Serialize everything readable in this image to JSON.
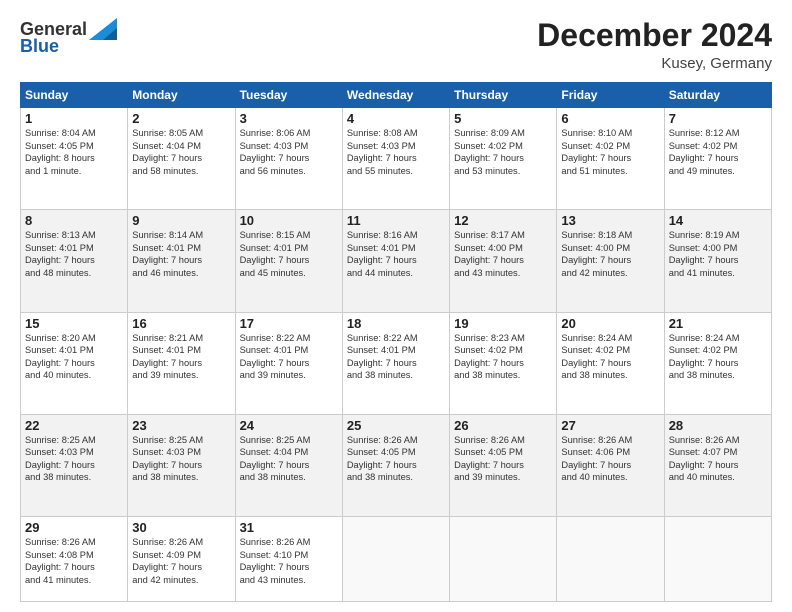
{
  "logo": {
    "general": "General",
    "blue": "Blue"
  },
  "header": {
    "month": "December 2024",
    "location": "Kusey, Germany"
  },
  "weekdays": [
    "Sunday",
    "Monday",
    "Tuesday",
    "Wednesday",
    "Thursday",
    "Friday",
    "Saturday"
  ],
  "weeks": [
    [
      {
        "day": "1",
        "info": "Sunrise: 8:04 AM\nSunset: 4:05 PM\nDaylight: 8 hours\nand 1 minute."
      },
      {
        "day": "2",
        "info": "Sunrise: 8:05 AM\nSunset: 4:04 PM\nDaylight: 7 hours\nand 58 minutes."
      },
      {
        "day": "3",
        "info": "Sunrise: 8:06 AM\nSunset: 4:03 PM\nDaylight: 7 hours\nand 56 minutes."
      },
      {
        "day": "4",
        "info": "Sunrise: 8:08 AM\nSunset: 4:03 PM\nDaylight: 7 hours\nand 55 minutes."
      },
      {
        "day": "5",
        "info": "Sunrise: 8:09 AM\nSunset: 4:02 PM\nDaylight: 7 hours\nand 53 minutes."
      },
      {
        "day": "6",
        "info": "Sunrise: 8:10 AM\nSunset: 4:02 PM\nDaylight: 7 hours\nand 51 minutes."
      },
      {
        "day": "7",
        "info": "Sunrise: 8:12 AM\nSunset: 4:02 PM\nDaylight: 7 hours\nand 49 minutes."
      }
    ],
    [
      {
        "day": "8",
        "info": "Sunrise: 8:13 AM\nSunset: 4:01 PM\nDaylight: 7 hours\nand 48 minutes."
      },
      {
        "day": "9",
        "info": "Sunrise: 8:14 AM\nSunset: 4:01 PM\nDaylight: 7 hours\nand 46 minutes."
      },
      {
        "day": "10",
        "info": "Sunrise: 8:15 AM\nSunset: 4:01 PM\nDaylight: 7 hours\nand 45 minutes."
      },
      {
        "day": "11",
        "info": "Sunrise: 8:16 AM\nSunset: 4:01 PM\nDaylight: 7 hours\nand 44 minutes."
      },
      {
        "day": "12",
        "info": "Sunrise: 8:17 AM\nSunset: 4:00 PM\nDaylight: 7 hours\nand 43 minutes."
      },
      {
        "day": "13",
        "info": "Sunrise: 8:18 AM\nSunset: 4:00 PM\nDaylight: 7 hours\nand 42 minutes."
      },
      {
        "day": "14",
        "info": "Sunrise: 8:19 AM\nSunset: 4:00 PM\nDaylight: 7 hours\nand 41 minutes."
      }
    ],
    [
      {
        "day": "15",
        "info": "Sunrise: 8:20 AM\nSunset: 4:01 PM\nDaylight: 7 hours\nand 40 minutes."
      },
      {
        "day": "16",
        "info": "Sunrise: 8:21 AM\nSunset: 4:01 PM\nDaylight: 7 hours\nand 39 minutes."
      },
      {
        "day": "17",
        "info": "Sunrise: 8:22 AM\nSunset: 4:01 PM\nDaylight: 7 hours\nand 39 minutes."
      },
      {
        "day": "18",
        "info": "Sunrise: 8:22 AM\nSunset: 4:01 PM\nDaylight: 7 hours\nand 38 minutes."
      },
      {
        "day": "19",
        "info": "Sunrise: 8:23 AM\nSunset: 4:02 PM\nDaylight: 7 hours\nand 38 minutes."
      },
      {
        "day": "20",
        "info": "Sunrise: 8:24 AM\nSunset: 4:02 PM\nDaylight: 7 hours\nand 38 minutes."
      },
      {
        "day": "21",
        "info": "Sunrise: 8:24 AM\nSunset: 4:02 PM\nDaylight: 7 hours\nand 38 minutes."
      }
    ],
    [
      {
        "day": "22",
        "info": "Sunrise: 8:25 AM\nSunset: 4:03 PM\nDaylight: 7 hours\nand 38 minutes."
      },
      {
        "day": "23",
        "info": "Sunrise: 8:25 AM\nSunset: 4:03 PM\nDaylight: 7 hours\nand 38 minutes."
      },
      {
        "day": "24",
        "info": "Sunrise: 8:25 AM\nSunset: 4:04 PM\nDaylight: 7 hours\nand 38 minutes."
      },
      {
        "day": "25",
        "info": "Sunrise: 8:26 AM\nSunset: 4:05 PM\nDaylight: 7 hours\nand 38 minutes."
      },
      {
        "day": "26",
        "info": "Sunrise: 8:26 AM\nSunset: 4:05 PM\nDaylight: 7 hours\nand 39 minutes."
      },
      {
        "day": "27",
        "info": "Sunrise: 8:26 AM\nSunset: 4:06 PM\nDaylight: 7 hours\nand 40 minutes."
      },
      {
        "day": "28",
        "info": "Sunrise: 8:26 AM\nSunset: 4:07 PM\nDaylight: 7 hours\nand 40 minutes."
      }
    ],
    [
      {
        "day": "29",
        "info": "Sunrise: 8:26 AM\nSunset: 4:08 PM\nDaylight: 7 hours\nand 41 minutes."
      },
      {
        "day": "30",
        "info": "Sunrise: 8:26 AM\nSunset: 4:09 PM\nDaylight: 7 hours\nand 42 minutes."
      },
      {
        "day": "31",
        "info": "Sunrise: 8:26 AM\nSunset: 4:10 PM\nDaylight: 7 hours\nand 43 minutes."
      },
      null,
      null,
      null,
      null
    ]
  ]
}
